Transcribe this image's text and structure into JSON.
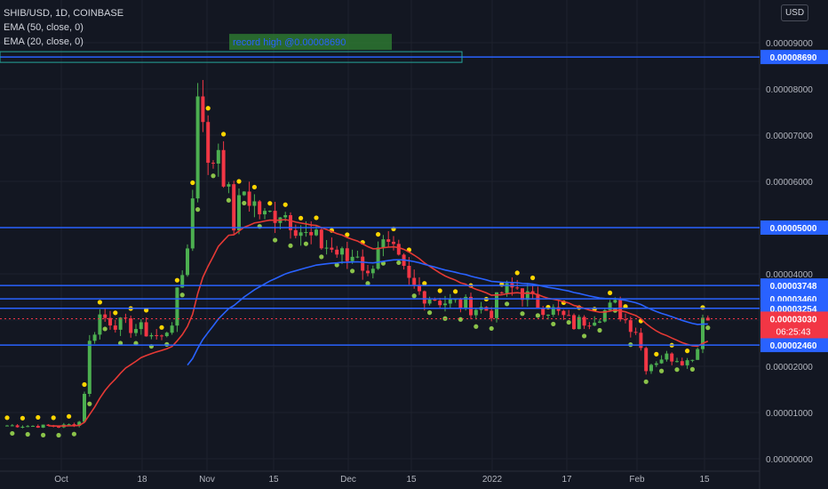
{
  "header": {
    "symbol": "SHIB/USD, 1D, COINBASE",
    "ema50": "EMA (50, close, 0)",
    "ema20": "EMA (20, close, 0)"
  },
  "currency_button": "USD",
  "colors": {
    "background": "#131722",
    "grid": "#1e222d",
    "up": "#26a69a",
    "candle_up": "#4caf50",
    "candle_down": "#f23645",
    "ema50": "#2962ff",
    "ema20": "#e53935",
    "level_line": "#2962ff",
    "dot_high": "#ffd600",
    "dot_low": "#8bc34a",
    "annotation_bg": "#2e7d32"
  },
  "chart_data": {
    "type": "candlestick",
    "title": "SHIB/USD, 1D, COINBASE",
    "x_tick_labels": [
      "Oct",
      "18",
      "Nov",
      "15",
      "Dec",
      "15",
      "2022",
      "17",
      "Feb",
      "15"
    ],
    "y_tick_labels": [
      "0.00009000",
      "0.00008000",
      "0.00007000",
      "0.00006000",
      "0.00004000",
      "0.00002000",
      "0.00001000",
      "0.00000000"
    ],
    "ylim": [
      0,
      9.3e-06
    ],
    "grid": true,
    "levels": [
      {
        "label": "0.00008690",
        "value": 8.69e-05
      },
      {
        "label": "0.00005000",
        "value": 5e-05
      },
      {
        "label": "0.00003748",
        "value": 3.748e-05
      },
      {
        "label": "0.00003460",
        "value": 3.46e-05
      },
      {
        "label": "0.00003254",
        "value": 3.254e-05
      },
      {
        "label": "0.00002460",
        "value": 2.46e-05
      }
    ],
    "last_price": {
      "label": "0.00003030",
      "value": 3.03e-05,
      "countdown": "06:25:43"
    },
    "annotation": {
      "text": "record high @0.00008690",
      "value": 8.69e-05
    },
    "indicators": [
      "EMA (50, close, 0)",
      "EMA (20, close, 0)"
    ]
  }
}
